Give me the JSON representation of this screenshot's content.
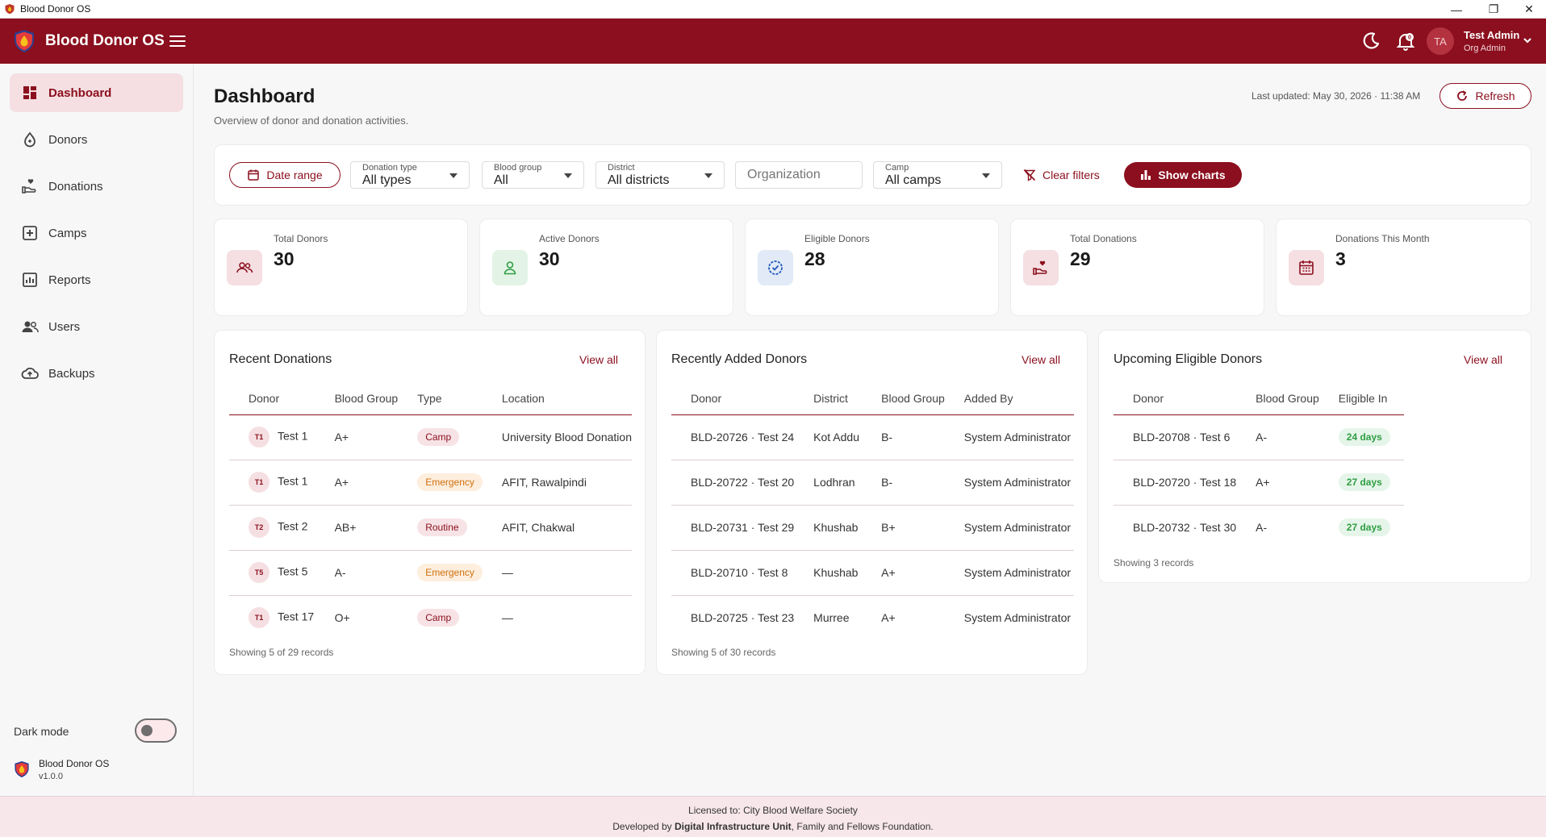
{
  "window": {
    "title": "Blood Donor OS"
  },
  "header": {
    "brand": "Blood Donor OS",
    "avatar_initials": "TA",
    "user_name": "Test Admin",
    "user_role": "Org Admin"
  },
  "sidebar": {
    "items": [
      {
        "label": "Dashboard",
        "icon": "dashboard-icon"
      },
      {
        "label": "Donors",
        "icon": "droplet-icon"
      },
      {
        "label": "Donations",
        "icon": "hand-heart-icon"
      },
      {
        "label": "Camps",
        "icon": "plus-box-icon"
      },
      {
        "label": "Reports",
        "icon": "chart-box-icon"
      },
      {
        "label": "Users",
        "icon": "users-icon"
      },
      {
        "label": "Backups",
        "icon": "cloud-upload-icon"
      }
    ],
    "dark_mode_label": "Dark mode",
    "app_name": "Blood Donor OS",
    "version": "v1.0.0"
  },
  "page": {
    "title": "Dashboard",
    "subtitle": "Overview of donor and donation activities.",
    "last_updated": "Last updated: May 30, 2026 · 11:38 AM",
    "refresh_label": "Refresh"
  },
  "filters": {
    "date_range_label": "Date range",
    "donation_type": {
      "label": "Donation type",
      "value": "All types"
    },
    "blood_group": {
      "label": "Blood group",
      "value": "All"
    },
    "district": {
      "label": "District",
      "value": "All districts"
    },
    "organization_placeholder": "Organization",
    "camp": {
      "label": "Camp",
      "value": "All camps"
    },
    "clear_label": "Clear filters",
    "charts_label": "Show charts"
  },
  "stats": [
    {
      "label": "Total Donors",
      "value": "30"
    },
    {
      "label": "Active Donors",
      "value": "30"
    },
    {
      "label": "Eligible Donors",
      "value": "28"
    },
    {
      "label": "Total Donations",
      "value": "29"
    },
    {
      "label": "Donations This Month",
      "value": "3"
    }
  ],
  "recent_donations": {
    "title": "Recent Donations",
    "view_all": "View all",
    "columns": [
      "Donor",
      "Blood Group",
      "Type",
      "Location"
    ],
    "rows": [
      {
        "initials": "T1",
        "donor": "Test 1",
        "blood": "A+",
        "type": "Camp",
        "location": "University Blood Donation"
      },
      {
        "initials": "T1",
        "donor": "Test 1",
        "blood": "A+",
        "type": "Emergency",
        "location": "AFIT, Rawalpindi"
      },
      {
        "initials": "T2",
        "donor": "Test 2",
        "blood": "AB+",
        "type": "Routine",
        "location": "AFIT, Chakwal"
      },
      {
        "initials": "T5",
        "donor": "Test 5",
        "blood": "A-",
        "type": "Emergency",
        "location": "—"
      },
      {
        "initials": "T1",
        "donor": "Test 17",
        "blood": "O+",
        "type": "Camp",
        "location": "—"
      }
    ],
    "showing": "Showing 5 of 29 records"
  },
  "recent_donors": {
    "title": "Recently Added Donors",
    "view_all": "View all",
    "columns": [
      "Donor",
      "District",
      "Blood Group",
      "Added By"
    ],
    "rows": [
      {
        "donor": "BLD-20726 · Test 24",
        "district": "Kot Addu",
        "blood": "B-",
        "added_by": "System Administrator"
      },
      {
        "donor": "BLD-20722 · Test 20",
        "district": "Lodhran",
        "blood": "B-",
        "added_by": "System Administrator"
      },
      {
        "donor": "BLD-20731 · Test 29",
        "district": "Khushab",
        "blood": "B+",
        "added_by": "System Administrator"
      },
      {
        "donor": "BLD-20710 · Test 8",
        "district": "Khushab",
        "blood": "A+",
        "added_by": "System Administrator"
      },
      {
        "donor": "BLD-20725 · Test 23",
        "district": "Murree",
        "blood": "A+",
        "added_by": "System Administrator"
      }
    ],
    "showing": "Showing 5 of 30 records"
  },
  "upcoming_eligible": {
    "title": "Upcoming Eligible Donors",
    "view_all": "View all",
    "columns": [
      "Donor",
      "Blood Group",
      "Eligible In"
    ],
    "rows": [
      {
        "donor": "BLD-20708 · Test 6",
        "blood": "A-",
        "eligible_in": "24 days"
      },
      {
        "donor": "BLD-20720 · Test 18",
        "blood": "A+",
        "eligible_in": "27 days"
      },
      {
        "donor": "BLD-20732 · Test 30",
        "blood": "A-",
        "eligible_in": "27 days"
      }
    ],
    "showing": "Showing 3 records"
  },
  "footer": {
    "licensed": "Licensed to: City Blood Welfare Society",
    "dev_prefix": "Developed by ",
    "dev_org": "Digital Infrastructure Unit",
    "dev_suffix": ", Family and Fellows Foundation."
  },
  "colors": {
    "brand": "#8b0f1e",
    "active_bg": "#f5dfe2",
    "emergency": "#d0700e",
    "eligible": "#2f9e44"
  }
}
